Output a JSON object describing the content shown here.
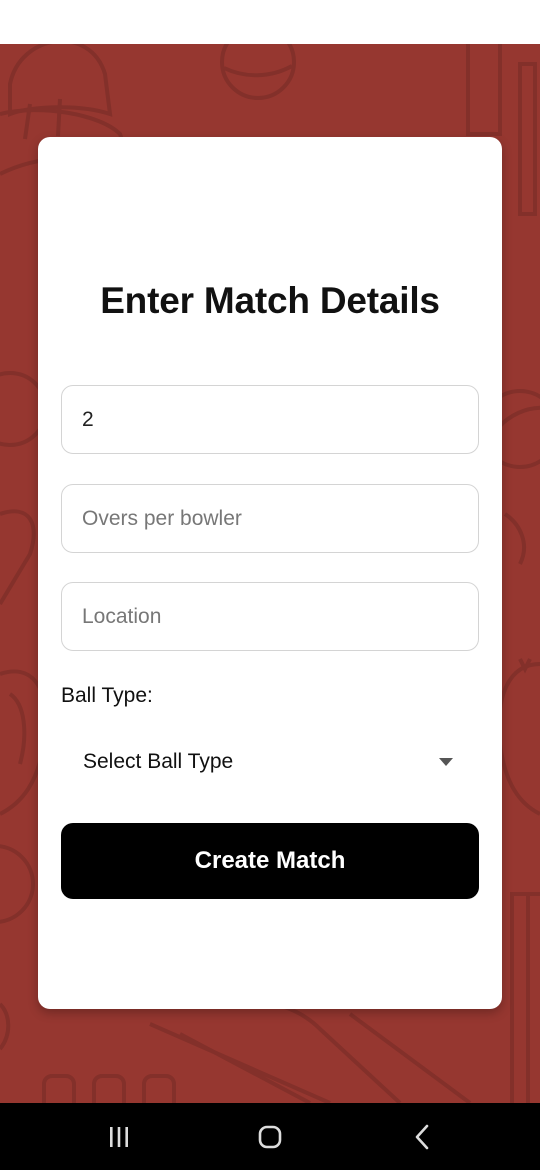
{
  "form": {
    "title": "Enter Match Details",
    "fields": [
      {
        "value": "2",
        "placeholder": ""
      },
      {
        "value": "",
        "placeholder": "Overs per bowler"
      },
      {
        "value": "",
        "placeholder": "Location"
      }
    ],
    "ball_type_label": "Ball Type:",
    "ball_type_selected": "Select Ball Type",
    "submit_label": "Create Match"
  },
  "theme": {
    "background": "#963730",
    "card": "#ffffff",
    "button": "#000000",
    "button_text": "#ffffff"
  },
  "icons": {
    "nav_recents": "recents-icon",
    "nav_home": "home-icon",
    "nav_back": "back-icon",
    "select_caret": "caret-down-icon"
  }
}
